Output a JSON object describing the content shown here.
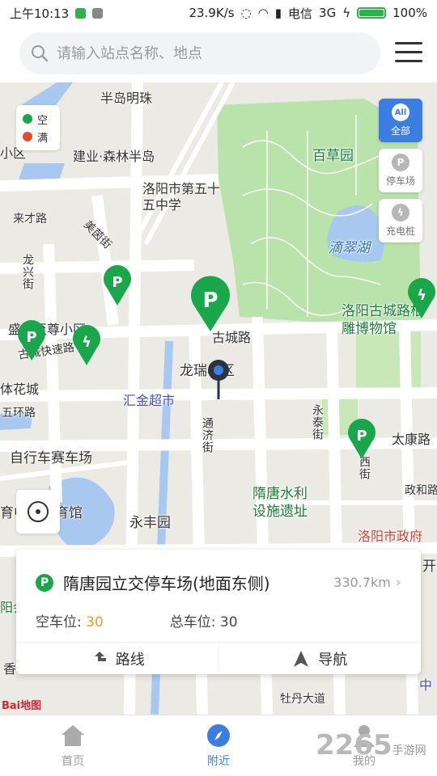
{
  "status": {
    "time": "上午10:13",
    "speed": "23.9K/s",
    "carrier": "电信",
    "network": "3G",
    "battery": "100%",
    "battery_level": 1.0
  },
  "search": {
    "placeholder": "请输入站点名称、地点"
  },
  "legend": {
    "empty": "空",
    "full": "满",
    "empty_color": "#1aa64b",
    "full_color": "#e24c2e"
  },
  "filters": {
    "all_icon": "All",
    "all": "全部",
    "parking": "停车场",
    "charging": "充电桩"
  },
  "map_labels": {
    "bandao_mingzhu": "半岛明珠",
    "jianye_senlin": "建业·森林半岛",
    "xiaoqu_edge": "小区",
    "school": "洛阳市第五十五中学",
    "laicai_road": "来才路",
    "meiyin_street": "美茵街",
    "longyi_street": "龙兴街",
    "baicao_garden": "百草园",
    "dicui_lake": "滴翠湖",
    "museum": "洛阳古城路根雕博物馆",
    "zhizun_xiaoqu": "盛世至尊小区",
    "gucheng_kuaisu": "古城快速路",
    "guchenglu": "古城路",
    "longrui_xiaoqu": "龙瑞小区",
    "tihuacheng": "体花城",
    "huijin_market": "汇金超市",
    "wuhuan_road": "五环路",
    "tongji_street": "通济街",
    "yongtai_street": "永泰街",
    "xi_street": "西街",
    "taikang_road": "太康路",
    "bike_track": "自行车赛车场",
    "zhenghe_road": "政和路",
    "water_site": "隋唐水利设施遗址",
    "sports_hall": "育中心体育馆",
    "yongfeng_garden": "永丰园",
    "gov": "洛阳市政府",
    "kai": "开",
    "yang": "阳会",
    "xiang": "香",
    "zhong": "中",
    "lower_road": "牡丹大道",
    "baidu": "Bai地图"
  },
  "card": {
    "name": "隋唐园立交停车场(地面东侧)",
    "distance": "330.7km",
    "empty_label": "空车位:",
    "empty_value": "30",
    "total_label": "总车位:",
    "total_value": "30",
    "route": "路线",
    "navigate": "导航"
  },
  "tabs": {
    "home": "首页",
    "nearby": "附近",
    "mine": "我的"
  },
  "watermark": {
    "brand": "2265",
    "site": "手游网"
  }
}
